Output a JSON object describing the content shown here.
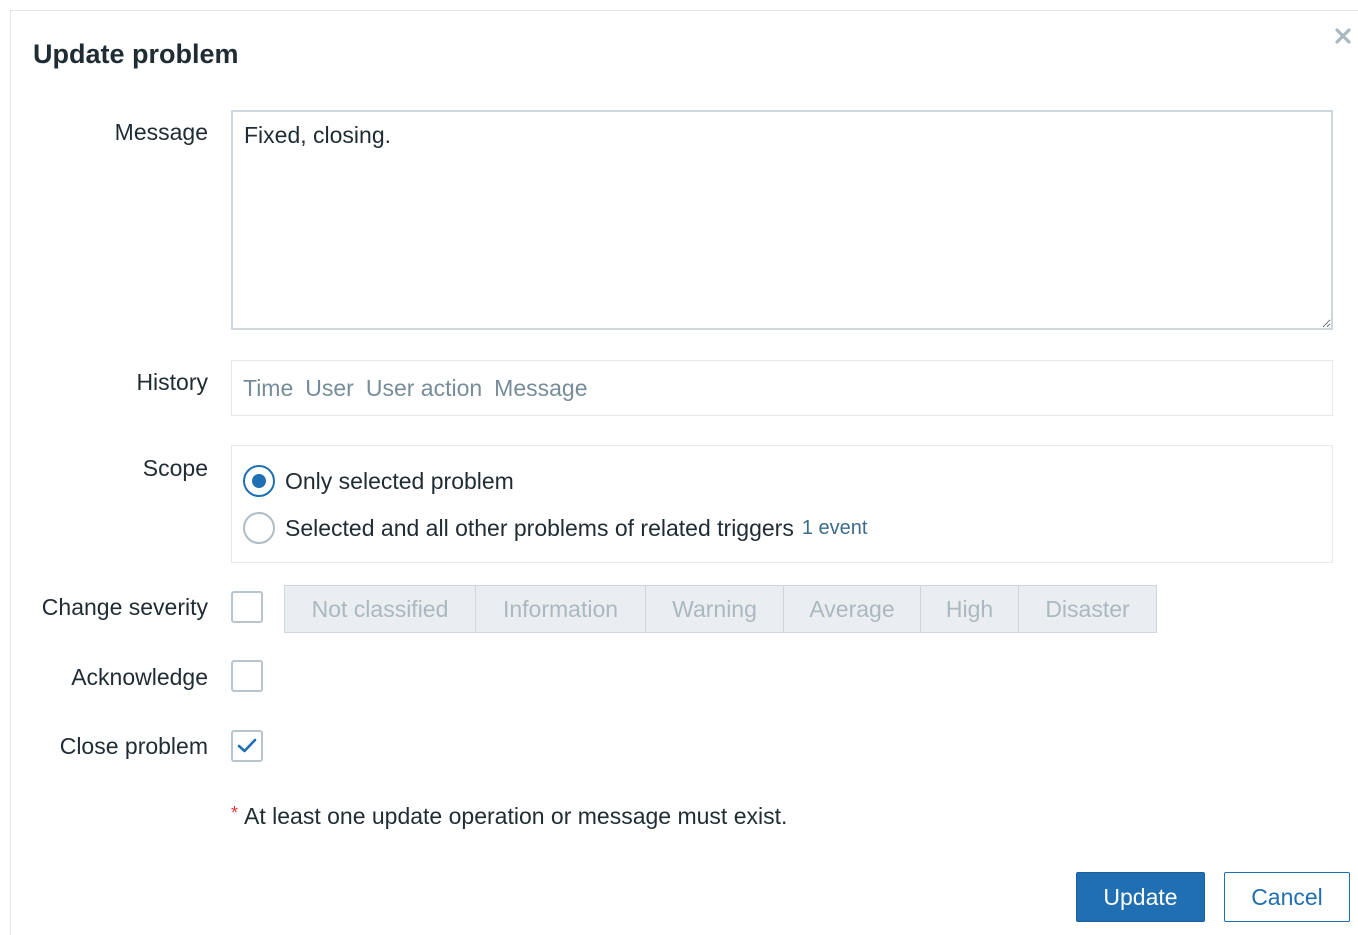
{
  "dialog": {
    "title": "Update problem",
    "close_icon": "close-icon"
  },
  "form": {
    "message_label": "Message",
    "message_value": "Fixed, closing.",
    "history_label": "History",
    "history_columns": [
      "Time",
      "User",
      "User action",
      "Message"
    ],
    "scope_label": "Scope",
    "scope_options": [
      {
        "label": "Only selected problem",
        "selected": true
      },
      {
        "label": "Selected and all other problems of related triggers",
        "selected": false,
        "suffix": "1 event"
      }
    ],
    "change_severity_label": "Change severity",
    "change_severity_checked": false,
    "severities": [
      "Not classified",
      "Information",
      "Warning",
      "Average",
      "High",
      "Disaster"
    ],
    "acknowledge_label": "Acknowledge",
    "acknowledge_checked": false,
    "close_problem_label": "Close problem",
    "close_problem_checked": true,
    "required_marker": "*",
    "note": "At least one update operation or message must exist."
  },
  "buttons": {
    "update": "Update",
    "cancel": "Cancel"
  },
  "colors": {
    "primary": "#1f6fb2",
    "required": "#e33734",
    "muted_text": "#768d99"
  }
}
